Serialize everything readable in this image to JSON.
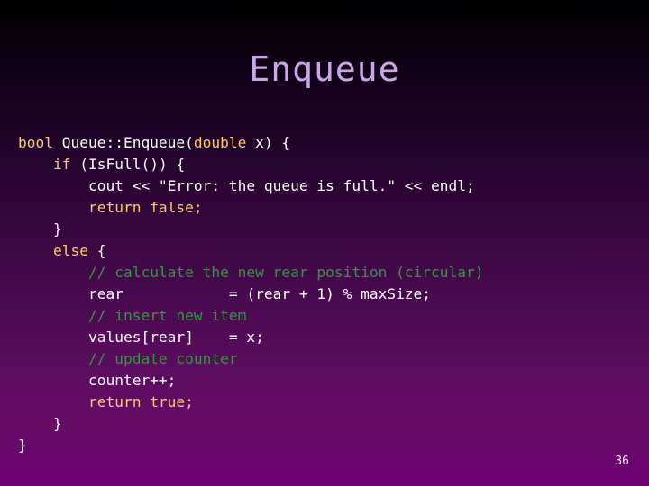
{
  "slide": {
    "title": "Enqueue",
    "page_number": "36",
    "title_color": "#cba7e8",
    "background_top_color": "#000000",
    "background_bottom_color": "#6d0070"
  },
  "code": {
    "language": "C++",
    "colors": {
      "plain": "#ffffff",
      "keyword": "#ffcc66",
      "comment": "#2f9b3a"
    },
    "lines": [
      {
        "id": "line-1",
        "text": "bool Queue::Enqueue(double x) {",
        "tokens": [
          {
            "t": "bool",
            "k": "keyword"
          },
          {
            "t": " Queue::Enqueue(",
            "k": "plain"
          },
          {
            "t": "double",
            "k": "keyword"
          },
          {
            "t": " x) {",
            "k": "plain"
          }
        ]
      },
      {
        "id": "line-2",
        "text": "    if (IsFull()) {",
        "tokens": [
          {
            "t": "    ",
            "k": "plain"
          },
          {
            "t": "if",
            "k": "keyword"
          },
          {
            "t": " (IsFull()) {",
            "k": "plain"
          }
        ]
      },
      {
        "id": "line-3",
        "text": "        cout << \"Error: the queue is full.\" << endl;",
        "tokens": [
          {
            "t": "        cout << \"Error: the queue is full.\" << endl;",
            "k": "plain"
          }
        ]
      },
      {
        "id": "line-4",
        "text": "        return false;",
        "tokens": [
          {
            "t": "        ",
            "k": "plain"
          },
          {
            "t": "return false;",
            "k": "keyword"
          }
        ]
      },
      {
        "id": "line-5",
        "text": "    }",
        "tokens": [
          {
            "t": "    }",
            "k": "plain"
          }
        ]
      },
      {
        "id": "line-6",
        "text": "    else {",
        "tokens": [
          {
            "t": "    ",
            "k": "plain"
          },
          {
            "t": "else",
            "k": "keyword"
          },
          {
            "t": " {",
            "k": "plain"
          }
        ]
      },
      {
        "id": "line-7",
        "text": "        // calculate the new rear position (circular)",
        "tokens": [
          {
            "t": "        ",
            "k": "plain"
          },
          {
            "t": "// calculate the new rear position (circular)",
            "k": "comment"
          }
        ]
      },
      {
        "id": "line-8",
        "text": "        rear            = (rear + 1) % maxSize;",
        "tokens": [
          {
            "t": "        rear            = (rear + 1) % maxSize;",
            "k": "plain"
          }
        ]
      },
      {
        "id": "line-9",
        "text": "        // insert new item",
        "tokens": [
          {
            "t": "        ",
            "k": "plain"
          },
          {
            "t": "// insert new item",
            "k": "comment"
          }
        ]
      },
      {
        "id": "line-10",
        "text": "        values[rear]    = x;",
        "tokens": [
          {
            "t": "        values[rear]    = x;",
            "k": "plain"
          }
        ]
      },
      {
        "id": "line-11",
        "text": "        // update counter",
        "tokens": [
          {
            "t": "        ",
            "k": "plain"
          },
          {
            "t": "// update counter",
            "k": "comment"
          }
        ]
      },
      {
        "id": "line-12",
        "text": "        counter++;",
        "tokens": [
          {
            "t": "        counter++;",
            "k": "plain"
          }
        ]
      },
      {
        "id": "line-13",
        "text": "        return true;",
        "tokens": [
          {
            "t": "        ",
            "k": "plain"
          },
          {
            "t": "return true;",
            "k": "keyword"
          }
        ]
      },
      {
        "id": "line-14",
        "text": "    }",
        "tokens": [
          {
            "t": "    }",
            "k": "plain"
          }
        ]
      },
      {
        "id": "line-15",
        "text": "}",
        "tokens": [
          {
            "t": "}",
            "k": "plain"
          }
        ]
      }
    ]
  }
}
